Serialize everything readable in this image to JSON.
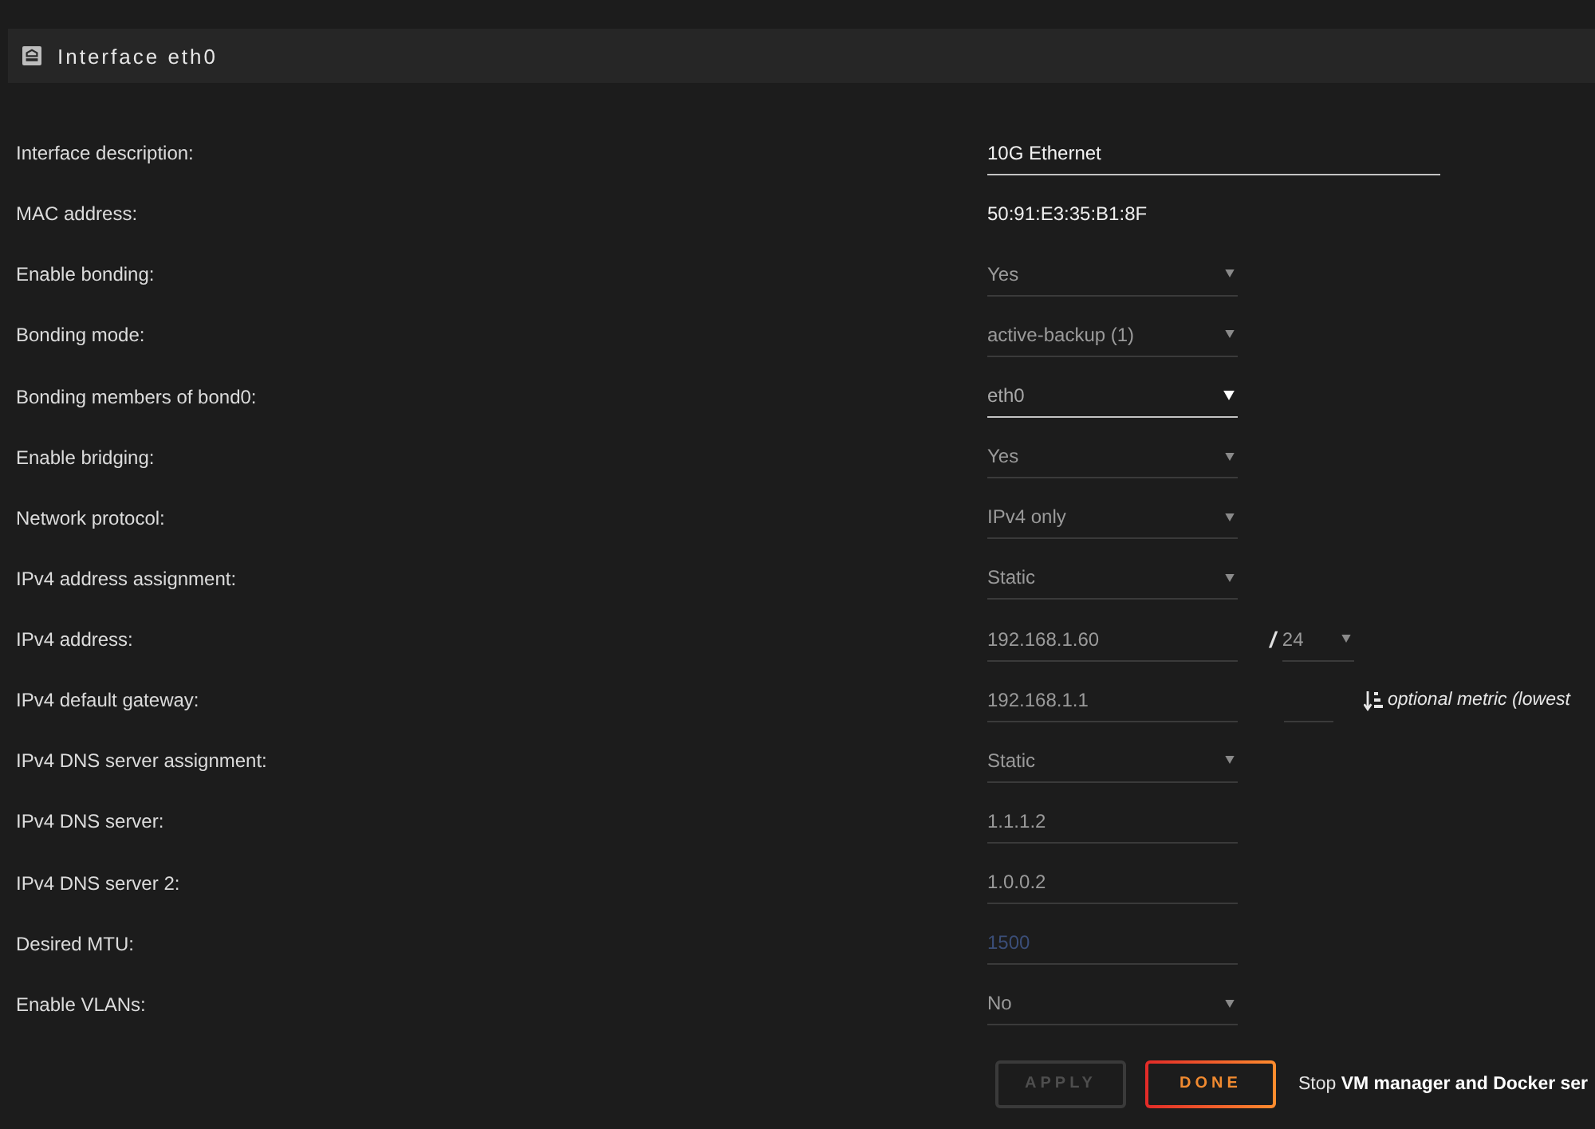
{
  "panel": {
    "title": "Interface eth0"
  },
  "settings": [
    {
      "label": "Interface description:",
      "kind": "text",
      "value": "10G Ethernet",
      "disabled": false
    },
    {
      "label": "MAC address:",
      "kind": "static",
      "value": "50:91:E3:35:B1:8F"
    },
    {
      "label": "Enable bonding:",
      "kind": "select",
      "value": "Yes",
      "disabled": true
    },
    {
      "label": "Bonding mode:",
      "kind": "select",
      "value": "active-backup (1)",
      "disabled": true
    },
    {
      "label": "Bonding members of bond0:",
      "kind": "select",
      "value": "eth0",
      "disabled": false
    },
    {
      "label": "Enable bridging:",
      "kind": "select",
      "value": "Yes",
      "disabled": true
    },
    {
      "label": "Network protocol:",
      "kind": "select",
      "value": "IPv4 only",
      "disabled": true
    },
    {
      "label": "IPv4 address assignment:",
      "kind": "select",
      "value": "Static",
      "disabled": true
    },
    {
      "label": "IPv4 address:",
      "kind": "cidr",
      "value": "192.168.1.60",
      "separator": "/",
      "prefix": "24",
      "disabled": true
    },
    {
      "label": "IPv4 default gateway:",
      "kind": "gateway",
      "value": "192.168.1.1",
      "hint": "optional metric (lowest",
      "disabled": true
    },
    {
      "label": "IPv4 DNS server assignment:",
      "kind": "select",
      "value": "Static",
      "disabled": true
    },
    {
      "label": "IPv4 DNS server:",
      "kind": "input",
      "value": "1.1.1.2",
      "disabled": true
    },
    {
      "label": "IPv4 DNS server 2:",
      "kind": "input",
      "value": "1.0.0.2",
      "disabled": true
    },
    {
      "label": "Desired MTU:",
      "kind": "input",
      "placeholder": "1500",
      "disabled": true
    },
    {
      "label": "Enable VLANs:",
      "kind": "select",
      "value": "No",
      "disabled": true
    }
  ],
  "buttons": [
    {
      "label": "APPLY",
      "disabled": true
    },
    {
      "label": "DONE",
      "disabled": false
    }
  ],
  "note": "Stop **VM manager and Docker ser**"
}
